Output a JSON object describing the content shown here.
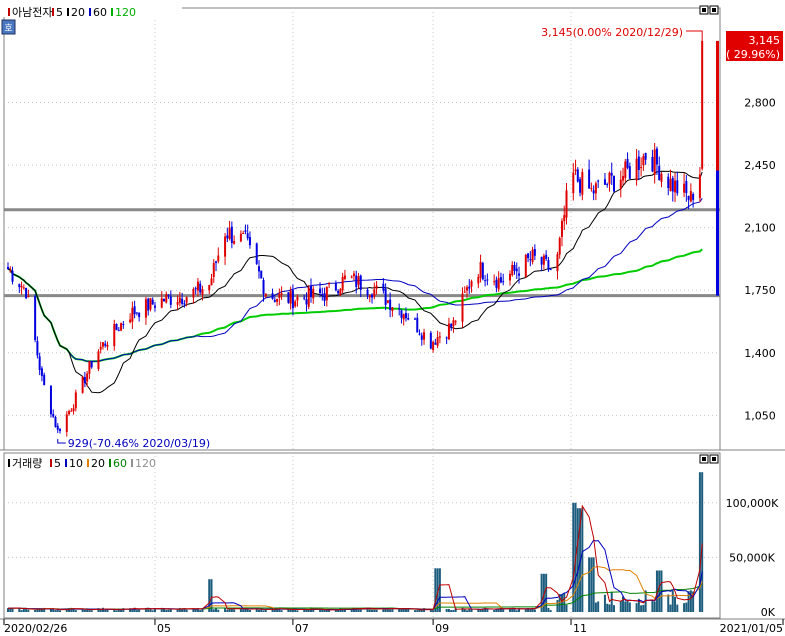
{
  "price_panel": {
    "icon_label": "호",
    "legend": [
      {
        "text": "아남전자",
        "color": "#c00000"
      },
      {
        "text": "5",
        "color": "#c00000"
      },
      {
        "text": "20",
        "color": "#000000"
      },
      {
        "text": "60",
        "color": "#0000c0"
      },
      {
        "text": "120",
        "color": "#00b000"
      }
    ],
    "current_price": "3,145",
    "current_change": "( 29.96%)",
    "high_annotation": "3,145(0.00% 2020/12/29)",
    "low_annotation": "929(-70.46% 2020/03/19)",
    "y_ticks": [
      "2,800",
      "2,450",
      "2,100",
      "1,750",
      "1,400",
      "1,050"
    ]
  },
  "volume_panel": {
    "legend": [
      {
        "text": "거래량",
        "color": "#000000"
      },
      {
        "text": "5",
        "color": "#c00000"
      },
      {
        "text": "10",
        "color": "#0000c0"
      },
      {
        "text": "20",
        "color": "#e08000"
      },
      {
        "text": "60",
        "color": "#008000"
      },
      {
        "text": "120",
        "color": "#909090"
      }
    ],
    "y_ticks": [
      "100,000K",
      "50,000K",
      "0K"
    ]
  },
  "x_axis": {
    "labels": [
      "2020/02/26",
      "05",
      "07",
      "09",
      "11",
      "2021/01/05"
    ]
  },
  "chart_data": {
    "type": "candlestick",
    "title": "아남전자",
    "x_range": [
      "2020/02/26",
      "2021/01/05"
    ],
    "price_ylim": [
      900,
      3200
    ],
    "volume_ylim": [
      0,
      130000
    ],
    "moving_averages": [
      "5",
      "20",
      "60",
      "120"
    ],
    "support_lines": [
      2200,
      1720
    ],
    "price_points": [
      {
        "date": "2020/02/26",
        "close": 1870
      },
      {
        "date": "2020/03/05",
        "close": 1750
      },
      {
        "date": "2020/03/12",
        "close": 1250
      },
      {
        "date": "2020/03/19",
        "close": 960
      },
      {
        "date": "2020/03/26",
        "close": 1120
      },
      {
        "date": "2020/04/05",
        "close": 1400
      },
      {
        "date": "2020/04/20",
        "close": 1620
      },
      {
        "date": "2020/05/05",
        "close": 1700
      },
      {
        "date": "2020/05/15",
        "close": 1720
      },
      {
        "date": "2020/05/25",
        "close": 1780
      },
      {
        "date": "2020/06/01",
        "close": 2080
      },
      {
        "date": "2020/06/10",
        "close": 2020
      },
      {
        "date": "2020/06/20",
        "close": 1720
      },
      {
        "date": "2020/07/01",
        "close": 1700
      },
      {
        "date": "2020/07/15",
        "close": 1730
      },
      {
        "date": "2020/07/25",
        "close": 1820
      },
      {
        "date": "2020/08/05",
        "close": 1760
      },
      {
        "date": "2020/08/20",
        "close": 1620
      },
      {
        "date": "2020/08/31",
        "close": 1460
      },
      {
        "date": "2020/09/10",
        "close": 1560
      },
      {
        "date": "2020/09/20",
        "close": 1880
      },
      {
        "date": "2020/10/01",
        "close": 1800
      },
      {
        "date": "2020/10/15",
        "close": 1930
      },
      {
        "date": "2020/10/25",
        "close": 1850
      },
      {
        "date": "2020/11/01",
        "close": 2400
      },
      {
        "date": "2020/11/10",
        "close": 2300
      },
      {
        "date": "2020/11/25",
        "close": 2400
      },
      {
        "date": "2020/12/05",
        "close": 2520
      },
      {
        "date": "2020/12/15",
        "close": 2350
      },
      {
        "date": "2020/12/24",
        "close": 2260
      },
      {
        "date": "2020/12/28",
        "close": 2420
      },
      {
        "date": "2020/12/29",
        "close": 3145
      }
    ],
    "volume_points": [
      {
        "date": "2020/05/25",
        "volume": 30000
      },
      {
        "date": "2020/09/03",
        "volume": 40000
      },
      {
        "date": "2020/10/20",
        "volume": 35000
      },
      {
        "date": "2020/11/03",
        "volume": 100000
      },
      {
        "date": "2020/11/05",
        "volume": 95000
      },
      {
        "date": "2020/11/10",
        "volume": 50000
      },
      {
        "date": "2020/12/10",
        "volume": 38000
      },
      {
        "date": "2020/12/29",
        "volume": 128000
      }
    ]
  }
}
